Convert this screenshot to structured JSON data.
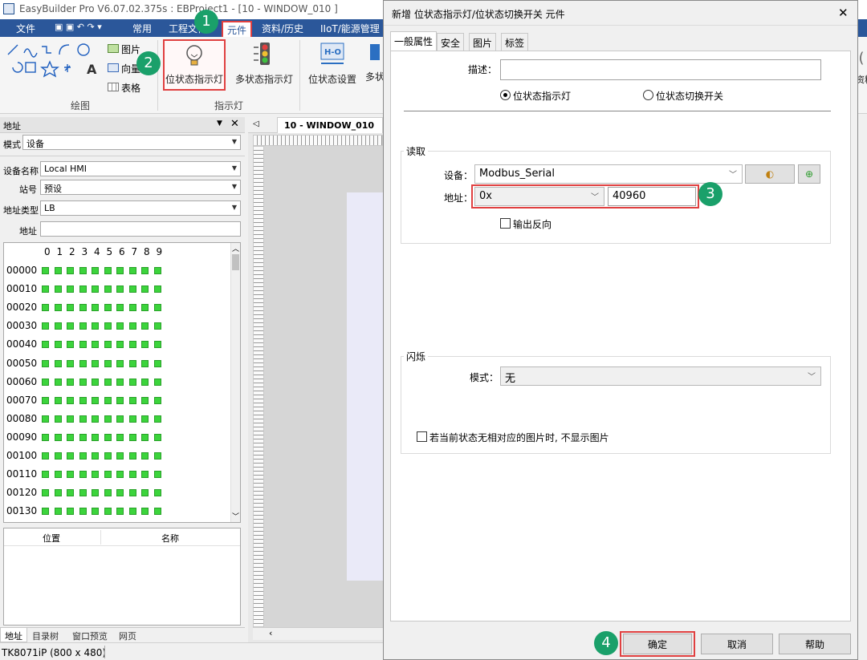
{
  "app": {
    "title": "EasyBuilder Pro V6.07.02.375s : EBProject1 - [10 - WINDOW_010 ]",
    "menu": [
      "文件",
      "常用",
      "工程文件",
      "元件",
      "资料/历史",
      "IIoT/能源管理"
    ]
  },
  "ribbon": {
    "draw_items": [
      "图片",
      "向量图",
      "表格"
    ],
    "draw_group": "绘图",
    "bit_lamp": "位状态指示灯",
    "multi_lamp": "多状态指示灯",
    "indicator_group": "指示灯",
    "bit_set": "位状态设置",
    "multi_set_partial": "多状",
    "right_partial": "资料"
  },
  "address_panel": {
    "title": "地址",
    "mode_label": "模式",
    "mode_value": "设备",
    "device_label": "设备名称",
    "device_value": "Local HMI",
    "station_label": "站号",
    "station_value": "预设",
    "addr_type_label": "地址类型",
    "addr_type_value": "LB",
    "address_label": "地址",
    "address_value": "",
    "col_headers": [
      "0",
      "1",
      "2",
      "3",
      "4",
      "5",
      "6",
      "7",
      "8",
      "9"
    ],
    "rows": [
      "00000",
      "00010",
      "00020",
      "00030",
      "00040",
      "00050",
      "00060",
      "00070",
      "00080",
      "00090",
      "00100",
      "00110",
      "00120",
      "00130"
    ],
    "table_headers": [
      "位置",
      "名称"
    ],
    "bottom_tabs": [
      "地址",
      "目录树",
      "窗口预览",
      "网页"
    ]
  },
  "workspace": {
    "tab_label": "10 - WINDOW_010"
  },
  "status": {
    "model": "TK8071iP (800 x 480)"
  },
  "dialog": {
    "title": "新增 位状态指示灯/位状态切换开关 元件",
    "tabs": [
      "一般属性",
      "安全",
      "图片",
      "标签"
    ],
    "desc_label": "描述：",
    "desc_value": "",
    "radio_lamp": "位状态指示灯",
    "radio_switch": "位状态切换开关",
    "read_group": "读取",
    "device_label": "设备：",
    "device_value": "Modbus_Serial",
    "address_label": "地址：",
    "address_type": "0x",
    "address_value": "40960",
    "invert_label": "输出反向",
    "blink_group": "闪烁",
    "mode_label": "模式：",
    "mode_value": "无",
    "no_image_label": "若当前状态无相对应的图片时, 不显示图片",
    "ok": "确定",
    "cancel": "取消",
    "help": "帮助"
  },
  "steps": [
    "1",
    "2",
    "3",
    "4"
  ],
  "colors": {
    "accent": "#2b579a",
    "badge": "#1aa06a",
    "highlight": "#e04040",
    "lamp_green": "#3cd43c"
  }
}
